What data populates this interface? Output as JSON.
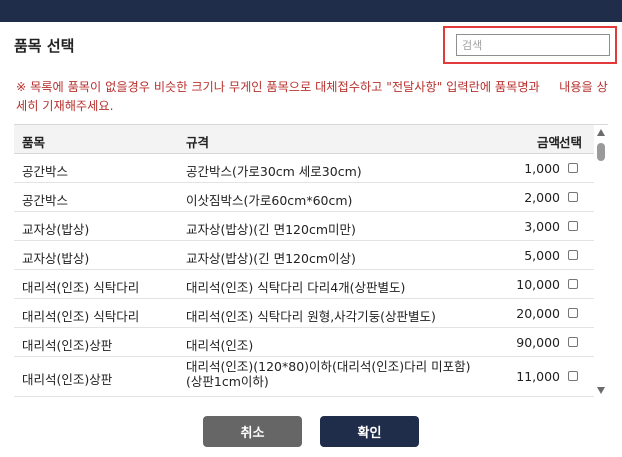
{
  "dialog": {
    "title": "품목 선택",
    "search_placeholder": "검색",
    "notice": "※ 목록에 품목이 없을경우 비슷한 크기나 무게인 품목으로 대체접수하고 \"전달사항\" 입력란에 품목명과     내용을 상세히 기재해주세요."
  },
  "table": {
    "headers": {
      "name": "품목",
      "spec": "규격",
      "price": "금액",
      "select": "선택"
    },
    "rows": [
      {
        "name": "공간박스",
        "spec": "공간박스(가로30cm 세로30cm)",
        "price": "1,000"
      },
      {
        "name": "공간박스",
        "spec": "이삿짐박스(가로60cm*60cm)",
        "price": "2,000"
      },
      {
        "name": "교자상(밥상)",
        "spec": "교자상(밥상)(긴 면120cm미만)",
        "price": "3,000"
      },
      {
        "name": "교자상(밥상)",
        "spec": "교자상(밥상)(긴 면120cm이상)",
        "price": "5,000"
      },
      {
        "name": "대리석(인조) 식탁다리",
        "spec": "대리석(인조) 식탁다리 다리4개(상판별도)",
        "price": "10,000"
      },
      {
        "name": "대리석(인조) 식탁다리",
        "spec": "대리석(인조) 식탁다리 원형,사각기둥(상판별도)",
        "price": "20,000"
      },
      {
        "name": "대리석(인조)상판",
        "spec": "대리석(인조)",
        "price": "90,000"
      },
      {
        "name": "대리석(인조)상판",
        "spec": "대리석(인조)(120*80)이하(대리석(인조)다리 미포함) (상판1cm이하)",
        "price": "11,000"
      }
    ]
  },
  "buttons": {
    "cancel": "취소",
    "confirm": "확인"
  },
  "colors": {
    "header_bar": "#1f2d4a",
    "notice_text": "#b8322f",
    "highlight_border": "#e23a3a",
    "cancel_bg": "#666666",
    "confirm_bg": "#1f2d4a"
  }
}
